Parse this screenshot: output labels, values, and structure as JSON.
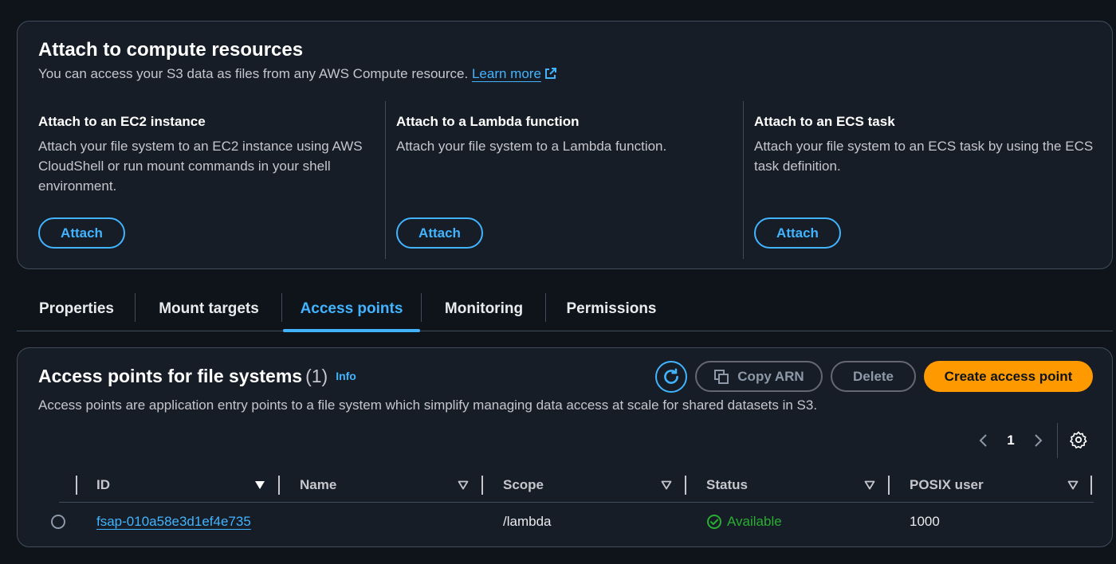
{
  "attach_panel": {
    "title": "Attach to compute resources",
    "description": "You can access your S3 data as files from any AWS Compute resource.",
    "learn_more": "Learn more",
    "options": [
      {
        "title": "Attach to an EC2 instance",
        "text": "Attach your file system to an EC2 instance using AWS CloudShell or run mount commands in your shell environment.",
        "button": "Attach"
      },
      {
        "title": "Attach to a Lambda function",
        "text": "Attach your file system to a Lambda function.",
        "button": "Attach"
      },
      {
        "title": "Attach to an ECS task",
        "text": "Attach your file system to an ECS task by using the ECS task definition.",
        "button": "Attach"
      }
    ]
  },
  "tabs": [
    {
      "label": "Properties",
      "active": false
    },
    {
      "label": "Mount targets",
      "active": false
    },
    {
      "label": "Access points",
      "active": true
    },
    {
      "label": "Monitoring",
      "active": false
    },
    {
      "label": "Permissions",
      "active": false
    }
  ],
  "access_points": {
    "title": "Access points for file systems",
    "count": "(1)",
    "info": "Info",
    "description": "Access points are application entry points to a file system which simplify managing data access at scale for shared datasets in S3.",
    "buttons": {
      "copy_arn": "Copy ARN",
      "delete": "Delete",
      "create": "Create access point"
    },
    "pagination": {
      "current_page": "1"
    },
    "columns": [
      "ID",
      "Name",
      "Scope",
      "Status",
      "POSIX user"
    ],
    "rows": [
      {
        "id": "fsap-010a58e3d1ef4e735",
        "name": "",
        "scope": "/lambda",
        "status": "Available",
        "posix_user": "1000"
      }
    ]
  },
  "colors": {
    "accent": "#42b4ff",
    "primary_button": "#ff9900",
    "status_available": "#29ad32",
    "background": "#0f141a",
    "panel": "#161d26"
  },
  "icons": [
    "external-link-icon",
    "refresh-icon",
    "copy-icon",
    "chevron-left-icon",
    "chevron-right-icon",
    "settings-icon",
    "sort-down-icon",
    "check-circle-icon",
    "radio-button"
  ]
}
